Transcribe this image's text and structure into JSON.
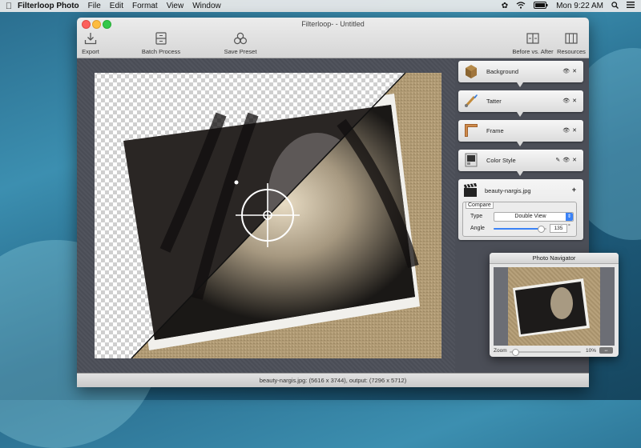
{
  "menubar": {
    "app_name": "Filterloop Photo",
    "items": [
      "File",
      "Edit",
      "Format",
      "View",
      "Window"
    ],
    "clock": "Mon 9:22 AM"
  },
  "window": {
    "title": "Filterloop- - Untitled"
  },
  "toolbar": {
    "export": "Export",
    "batch": "Batch Process",
    "save_preset": "Save Preset",
    "before_after": "Before vs. After",
    "resources": "Resources"
  },
  "layers": [
    {
      "name": "Background",
      "icon": "box-icon"
    },
    {
      "name": "Tatter",
      "icon": "brush-icon"
    },
    {
      "name": "Frame",
      "icon": "frame-icon"
    },
    {
      "name": "Color Style",
      "icon": "color-style-icon"
    }
  ],
  "file_layer": {
    "name": "beauty-nargis.jpg",
    "compare_label": "Compare",
    "type_label": "Type",
    "type_value": "Double View",
    "angle_label": "Angle",
    "angle_value": "135",
    "angle_unit": "°",
    "angle_fraction": 0.9
  },
  "navigator": {
    "title": "Photo Navigator",
    "zoom_label": "Zoom",
    "zoom_value": "10%",
    "zoom_fraction": 0.08
  },
  "status": "beauty-nargis.jpg: (5616 x 3744), output: (7296 x 5712)",
  "colors": {
    "window_bg": "#4b4e57",
    "canvas_burlap": "#b09a74",
    "accent": "#3b82f6"
  }
}
